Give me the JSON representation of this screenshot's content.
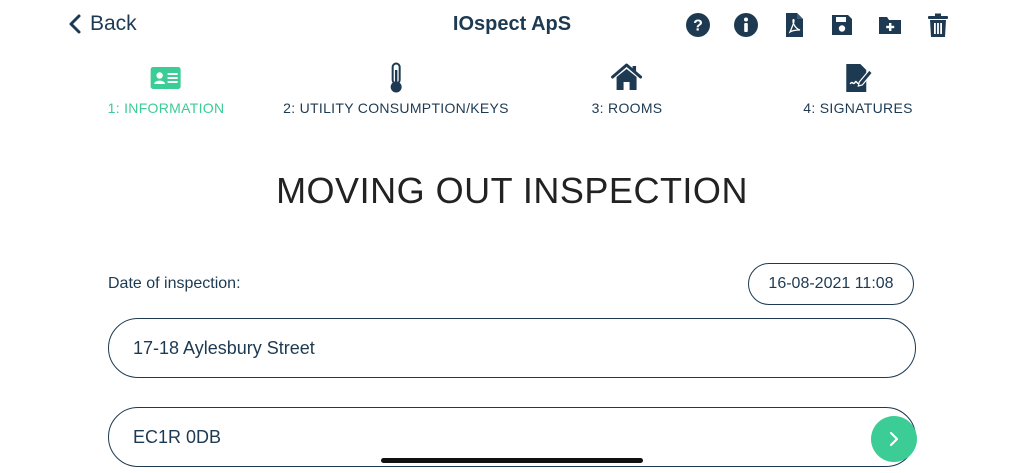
{
  "header": {
    "back_label": "Back",
    "title": "IOspect ApS",
    "toolbar_icons": [
      "help-icon",
      "info-icon",
      "pdf-icon",
      "save-icon",
      "add-folder-icon",
      "trash-icon"
    ]
  },
  "steps": [
    {
      "label": "1: INFORMATION",
      "icon": "id-card-icon",
      "active": true
    },
    {
      "label": "2: UTILITY CONSUMPTION/KEYS",
      "icon": "thermometer-icon",
      "active": false
    },
    {
      "label": "3: ROOMS",
      "icon": "house-icon",
      "active": false
    },
    {
      "label": "4: SIGNATURES",
      "icon": "signature-icon",
      "active": false
    }
  ],
  "main": {
    "heading": "MOVING OUT INSPECTION",
    "date_label": "Date of inspection:",
    "date_value": "16-08-2021 11:08",
    "address_value": "17-18 Aylesbury Street",
    "postcode_value": "EC1R 0DB"
  },
  "colors": {
    "primary": "#1d3a52",
    "accent": "#3ccc95",
    "heading": "#222222"
  }
}
